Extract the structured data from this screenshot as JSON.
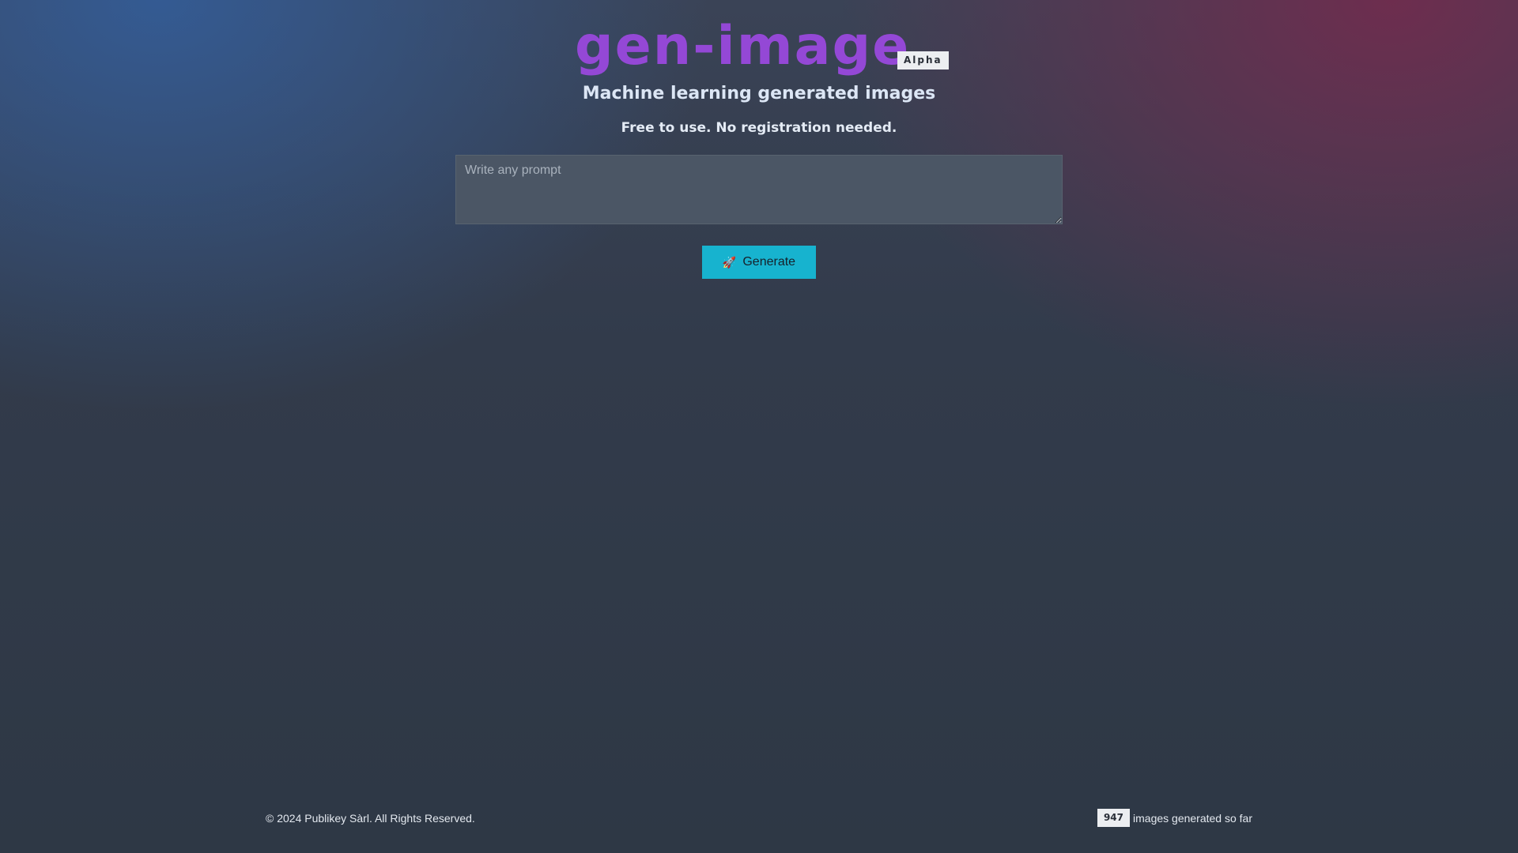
{
  "header": {
    "title": "gen-image",
    "badge": "Alpha",
    "subtitle": "Machine learning generated images",
    "tagline": "Free to use. No registration needed."
  },
  "prompt": {
    "placeholder": "Write any prompt",
    "value": ""
  },
  "generate_button": {
    "label": "Generate",
    "icon": "rocket-icon"
  },
  "footer": {
    "copyright": "© 2024 Publikey Sàrl. All Rights Reserved.",
    "images_count": "947",
    "images_count_suffix": "images generated so far"
  },
  "colors": {
    "title": "#9448d6",
    "button": "#17b3cf",
    "input_bg": "#4b5665"
  }
}
